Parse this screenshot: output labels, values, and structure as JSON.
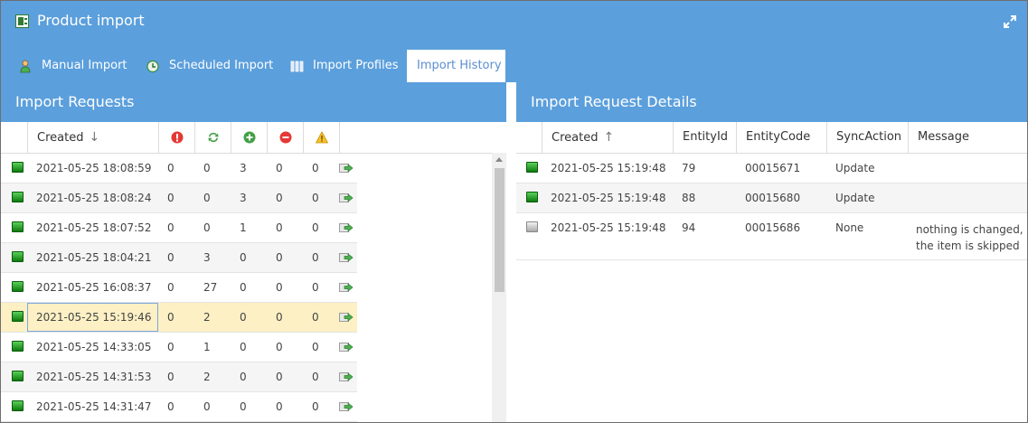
{
  "window": {
    "title": "Product import"
  },
  "tabs": [
    {
      "label": "Manual Import",
      "icon": "user-import-icon"
    },
    {
      "label": "Scheduled Import",
      "icon": "scheduled-clock-icon"
    },
    {
      "label": "Import Profiles",
      "icon": "profiles-icon"
    },
    {
      "label": "Import History",
      "icon": "history-icon",
      "active": true
    }
  ],
  "requests": {
    "title": "Import Requests",
    "columns": {
      "created": "Created",
      "sort_arrow": "↓"
    },
    "header_icons": [
      "error-icon",
      "sync-icon",
      "add-icon",
      "remove-icon",
      "warning-icon"
    ],
    "rows": [
      {
        "created": "2021-05-25 18:08:59",
        "c1": "0",
        "c2": "0",
        "c3": "3",
        "c4": "0",
        "c5": "0"
      },
      {
        "created": "2021-05-25 18:08:24",
        "c1": "0",
        "c2": "0",
        "c3": "3",
        "c4": "0",
        "c5": "0"
      },
      {
        "created": "2021-05-25 18:07:52",
        "c1": "0",
        "c2": "0",
        "c3": "1",
        "c4": "0",
        "c5": "0"
      },
      {
        "created": "2021-05-25 18:04:21",
        "c1": "0",
        "c2": "3",
        "c3": "0",
        "c4": "0",
        "c5": "0"
      },
      {
        "created": "2021-05-25 16:08:37",
        "c1": "0",
        "c2": "27",
        "c3": "0",
        "c4": "0",
        "c5": "0"
      },
      {
        "created": "2021-05-25 15:19:46",
        "c1": "0",
        "c2": "2",
        "c3": "0",
        "c4": "0",
        "c5": "0",
        "selected": true
      },
      {
        "created": "2021-05-25 14:33:05",
        "c1": "0",
        "c2": "1",
        "c3": "0",
        "c4": "0",
        "c5": "0"
      },
      {
        "created": "2021-05-25 14:31:53",
        "c1": "0",
        "c2": "2",
        "c3": "0",
        "c4": "0",
        "c5": "0"
      },
      {
        "created": "2021-05-25 14:31:47",
        "c1": "0",
        "c2": "0",
        "c3": "0",
        "c4": "0",
        "c5": "0"
      }
    ]
  },
  "details": {
    "title": "Import Request Details",
    "columns": {
      "created": "Created",
      "sort_arrow": "↑",
      "entity_id": "EntityId",
      "entity_code": "EntityCode",
      "sync_action": "SyncAction",
      "message": "Message"
    },
    "rows": [
      {
        "status": "green",
        "created": "2021-05-25 15:19:48",
        "entity_id": "79",
        "entity_code": "00015671",
        "sync_action": "Update",
        "message_1": "",
        "message_2": ""
      },
      {
        "status": "green",
        "created": "2021-05-25 15:19:48",
        "entity_id": "88",
        "entity_code": "00015680",
        "sync_action": "Update",
        "message_1": "",
        "message_2": ""
      },
      {
        "status": "grey",
        "created": "2021-05-25 15:19:48",
        "entity_id": "94",
        "entity_code": "00015686",
        "sync_action": "None",
        "message_1": "nothing is changed,",
        "message_2": "the item is skipped"
      }
    ]
  }
}
